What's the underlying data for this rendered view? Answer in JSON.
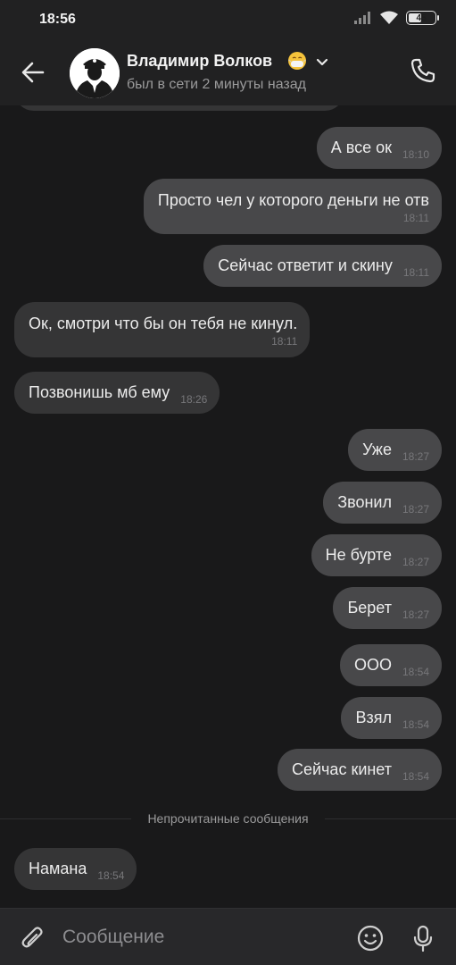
{
  "status_bar": {
    "time": "18:56",
    "battery_level": "45",
    "icons": [
      "signal-icon",
      "wifi-icon",
      "battery-icon"
    ]
  },
  "header": {
    "contact_name": "Владимир Волков",
    "name_emoji": "mask-face-emoji",
    "last_seen": "был в сети 2 минуты назад",
    "icons": [
      "back-arrow-icon",
      "chevron-down-icon",
      "phone-icon"
    ]
  },
  "messages": [
    {
      "direction": "out",
      "text": "А все ок",
      "time": "18:10"
    },
    {
      "direction": "out",
      "text": "Просто чел у которого деньги не отв",
      "time": "18:11"
    },
    {
      "direction": "out",
      "text": "Сейчас ответит и скину",
      "time": "18:11"
    },
    {
      "direction": "in",
      "text": "Ок, смотри что бы он тебя не кинул.",
      "time": "18:11"
    },
    {
      "direction": "in",
      "text": "Позвонишь мб ему",
      "time": "18:26"
    },
    {
      "direction": "out",
      "text": "Уже",
      "time": "18:27"
    },
    {
      "direction": "out",
      "text": "Звонил",
      "time": "18:27"
    },
    {
      "direction": "out",
      "text": "Не бурте",
      "time": "18:27"
    },
    {
      "direction": "out",
      "text": "Берет",
      "time": "18:27"
    },
    {
      "direction": "out",
      "text": "ООО",
      "time": "18:54"
    },
    {
      "direction": "out",
      "text": "Взял",
      "time": "18:54"
    },
    {
      "direction": "out",
      "text": "Сейчас кинет",
      "time": "18:54"
    },
    {
      "direction": "in",
      "text": "Намана",
      "time": "18:54"
    }
  ],
  "unread_divider": "Непрочитанные сообщения",
  "composer": {
    "placeholder": "Сообщение",
    "value": "",
    "icons": [
      "paperclip-icon",
      "smile-icon",
      "microphone-icon"
    ]
  },
  "colors": {
    "background": "#19191a",
    "header": "#212122",
    "outgoing_bubble": "#48484a",
    "incoming_bubble": "#353536",
    "composer": "#28282a"
  }
}
